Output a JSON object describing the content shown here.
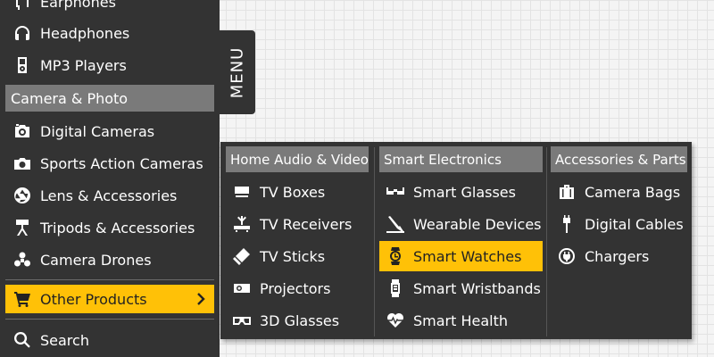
{
  "sidebar": {
    "items_top": [
      {
        "label": "Earphones",
        "icon": "earphones-icon"
      },
      {
        "label": "Headphones",
        "icon": "headphones-icon"
      },
      {
        "label": "MP3 Players",
        "icon": "mp3-player-icon"
      }
    ],
    "section_header": "Camera & Photo",
    "items_mid": [
      {
        "label": "Digital Cameras",
        "icon": "digital-camera-icon"
      },
      {
        "label": "Sports Action Cameras",
        "icon": "action-camera-icon"
      },
      {
        "label": "Lens & Accessories",
        "icon": "lens-icon"
      },
      {
        "label": "Tripods & Accessories",
        "icon": "tripod-icon"
      },
      {
        "label": "Camera Drones",
        "icon": "drone-icon"
      }
    ],
    "active_item": {
      "label": "Other Products",
      "icon": "cart-icon",
      "chevron": "chevron-right-icon"
    },
    "search": {
      "label": "Search",
      "icon": "search-icon"
    }
  },
  "menu_tab": {
    "label": "MENU"
  },
  "mega_menu": {
    "columns": [
      {
        "header": "Home Audio & Video",
        "items": [
          {
            "label": "TV Boxes",
            "icon": "tv-box-icon"
          },
          {
            "label": "TV Receivers",
            "icon": "tv-receiver-icon"
          },
          {
            "label": "TV Sticks",
            "icon": "tv-stick-icon"
          },
          {
            "label": "Projectors",
            "icon": "projector-icon"
          },
          {
            "label": "3D Glasses",
            "icon": "3d-glasses-icon"
          }
        ]
      },
      {
        "header": "Smart Electronics",
        "items": [
          {
            "label": "Smart Glasses",
            "icon": "smart-glasses-icon"
          },
          {
            "label": "Wearable Devices",
            "icon": "wearable-icon"
          },
          {
            "label": "Smart Watches",
            "icon": "smart-watch-icon",
            "active": true
          },
          {
            "label": "Smart Wristbands",
            "icon": "wristband-icon"
          },
          {
            "label": "Smart Health",
            "icon": "heartbeat-icon"
          }
        ]
      },
      {
        "header": "Accessories & Parts",
        "items": [
          {
            "label": "Camera Bags",
            "icon": "camera-bag-icon"
          },
          {
            "label": "Digital Cables",
            "icon": "usb-cable-icon"
          },
          {
            "label": "Chargers",
            "icon": "charger-plug-icon"
          }
        ]
      }
    ]
  },
  "colors": {
    "panel_bg": "#333333",
    "header_bg": "#7a7a7a",
    "accent": "#ffc107",
    "text": "#ffffff"
  }
}
